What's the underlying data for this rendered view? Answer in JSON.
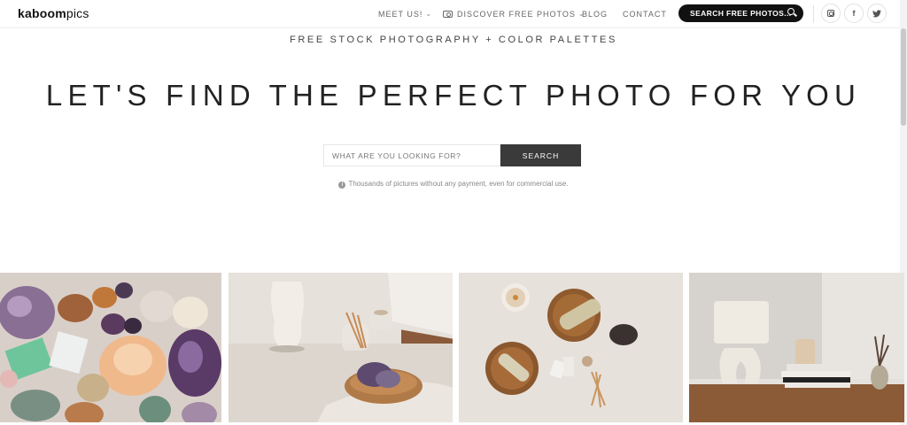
{
  "header": {
    "logo_bold": "kaboom",
    "logo_light": "pics",
    "nav": {
      "meet": "MEET US!",
      "discover": "DISCOVER FREE PHOTOS",
      "blog": "BLOG",
      "contact": "CONTACT"
    },
    "search_pill": "SEARCH FREE PHOTOS...",
    "social": {
      "facebook": "f",
      "twitter": "t"
    }
  },
  "hero": {
    "tagline": "FREE STOCK PHOTOGRAPHY + COLOR PALETTES",
    "headline": "LET'S FIND THE PERFECT PHOTO FOR YOU",
    "search_placeholder": "WHAT ARE YOU LOOKING FOR?",
    "search_button": "SEARCH",
    "info_icon": "i",
    "info_text": "Thousands of pictures without any payment, even for commercial use."
  },
  "gallery": {
    "items": [
      {
        "icon": "crystals-photo"
      },
      {
        "icon": "torso-sculpture-photo"
      },
      {
        "icon": "sage-bowls-photo"
      },
      {
        "icon": "lamp-books-photo"
      }
    ]
  },
  "colors": {
    "pill_bg": "#111111",
    "search_button_bg": "#3a3a3a",
    "text": "#222222"
  }
}
